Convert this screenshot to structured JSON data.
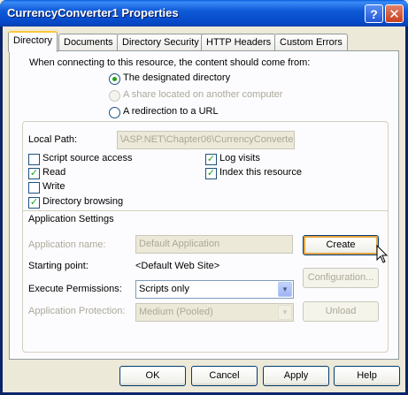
{
  "window": {
    "title": "CurrencyConverter1 Properties",
    "help_glyph": "?",
    "close_glyph": "✕"
  },
  "tabs": [
    {
      "label": "Directory",
      "active": true
    },
    {
      "label": "Documents"
    },
    {
      "label": "Directory Security"
    },
    {
      "label": "HTTP Headers"
    },
    {
      "label": "Custom Errors"
    }
  ],
  "directory": {
    "intro": "When connecting to this resource, the content should come from:",
    "sources": [
      {
        "label": "The designated directory",
        "checked": true,
        "enabled": true
      },
      {
        "label": "A share located on another computer",
        "checked": false,
        "enabled": false
      },
      {
        "label": "A redirection to a URL",
        "checked": false,
        "enabled": true
      }
    ],
    "local_path": {
      "label": "Local Path:",
      "value": "\\ASP.NET\\Chapter06\\CurrencyConverte"
    },
    "permissions": [
      {
        "label": "Script source access",
        "checked": false
      },
      {
        "label": "Read",
        "checked": true
      },
      {
        "label": "Write",
        "checked": false
      },
      {
        "label": "Directory browsing",
        "checked": true
      },
      {
        "label": "Log visits",
        "checked": true
      },
      {
        "label": "Index this resource",
        "checked": true
      }
    ],
    "check_glyph": "✓"
  },
  "app_settings": {
    "heading": "Application Settings",
    "app_name_label": "Application name:",
    "app_name_value": "Default Application",
    "create_button": "Create",
    "starting_point_label": "Starting point:",
    "starting_point_value": "<Default Web Site>",
    "configuration_button": "Configuration...",
    "execute_permissions_label": "Execute Permissions:",
    "execute_permissions_value": "Scripts only",
    "app_protection_label": "Application Protection:",
    "app_protection_value": "Medium (Pooled)",
    "unload_button": "Unload",
    "dropdown_glyph": "▼"
  },
  "footer": {
    "ok": "OK",
    "cancel": "Cancel",
    "apply": "Apply",
    "help": "Help"
  }
}
